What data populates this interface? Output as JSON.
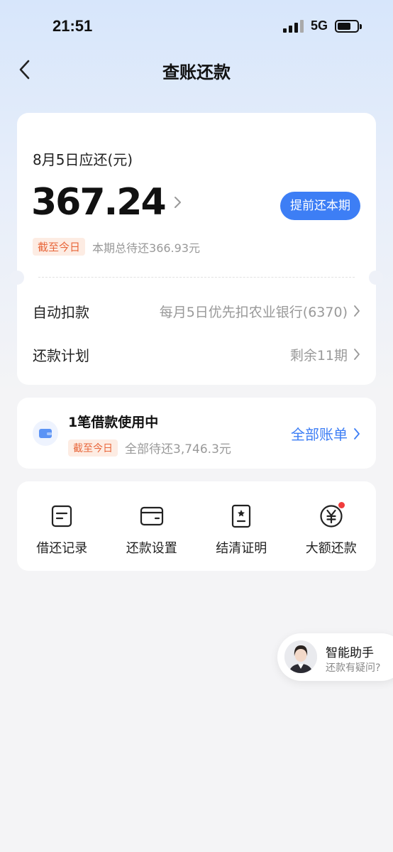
{
  "status_bar": {
    "time": "21:51",
    "network": "5G"
  },
  "nav": {
    "title": "查账还款"
  },
  "bill": {
    "due_label": "8月5日应还(元)",
    "amount": "367.24",
    "prepay_button": "提前还本期",
    "as_of_tag": "截至今日",
    "total_pending": "本期总待还366.93元",
    "auto_debit_label": "自动扣款",
    "auto_debit_value": "每月5日优先扣农业银行(6370)",
    "plan_label": "还款计划",
    "plan_value": "剩余11期"
  },
  "loan": {
    "title": "1笔借款使用中",
    "as_of_tag": "截至今日",
    "total_pending": "全部待还3,746.3元",
    "all_bills_link": "全部账单"
  },
  "tools": [
    {
      "label": "借还记录",
      "icon": "record-icon"
    },
    {
      "label": "还款设置",
      "icon": "card-settings-icon"
    },
    {
      "label": "结清证明",
      "icon": "certificate-icon"
    },
    {
      "label": "大额还款",
      "icon": "yuan-icon",
      "badge": true
    }
  ],
  "assistant": {
    "title": "智能助手",
    "subtitle": "还款有疑问?"
  },
  "colors": {
    "accent": "#3d7ef5",
    "tag_text": "#e8663a",
    "tag_bg": "#fdece3",
    "badge": "#f03c3c"
  }
}
